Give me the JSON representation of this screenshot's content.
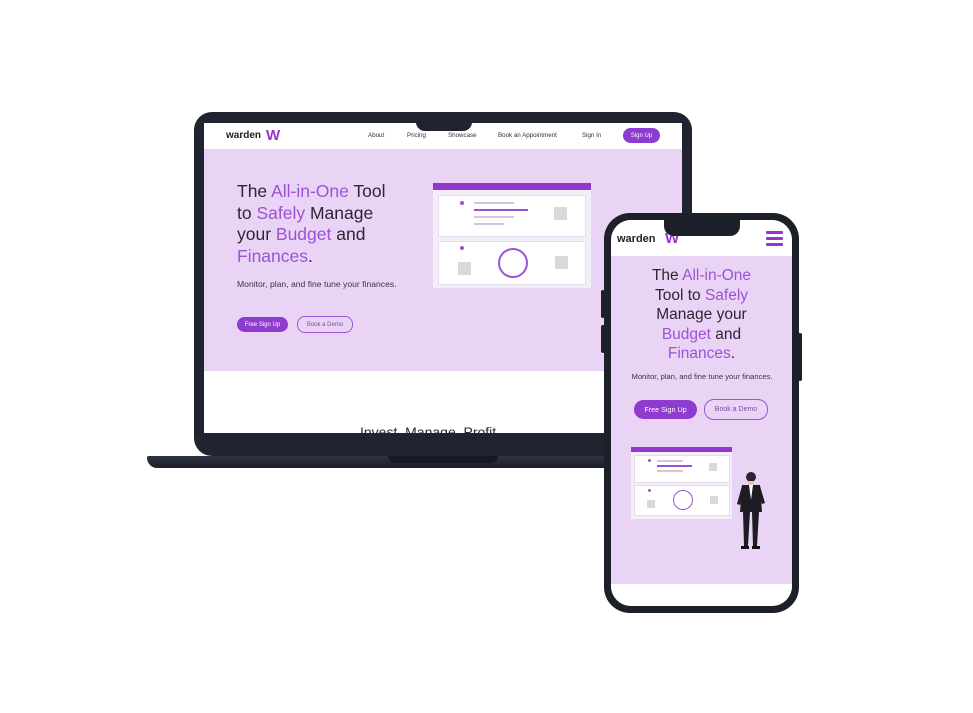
{
  "brand": {
    "name": "warden",
    "logo_mark": "W"
  },
  "nav": {
    "items": [
      "About",
      "Pricing",
      "Showcase",
      "Book an Appointment",
      "Sign In"
    ],
    "signup": "Sign Up"
  },
  "hero": {
    "headline": {
      "the": "The ",
      "all_in_one": "All-in-One",
      "tool": " Tool",
      "to": "to ",
      "safely": "Safely",
      "manage": " Manage",
      "your": "your ",
      "budget": "Budget",
      "and": " and",
      "finances": "Finances",
      "period": ".",
      "tool_to": " Tool to ",
      "manage_your": "Manage your",
      "and_space": " and"
    },
    "subtitle": "Monitor, plan, and fine tune your finances.",
    "primary_cta": "Free Sign Up",
    "secondary_cta": "Book a Demo"
  },
  "section": {
    "heading": "Invest. Manage. Profit."
  },
  "colors": {
    "accent": "#9c52d6",
    "brand": "#8e3bd0",
    "hero_bg": "#ead4f5",
    "device": "#1f2430"
  },
  "icons": {
    "menu": "hamburger-menu-icon",
    "logo": "warden-w-logo-icon"
  }
}
